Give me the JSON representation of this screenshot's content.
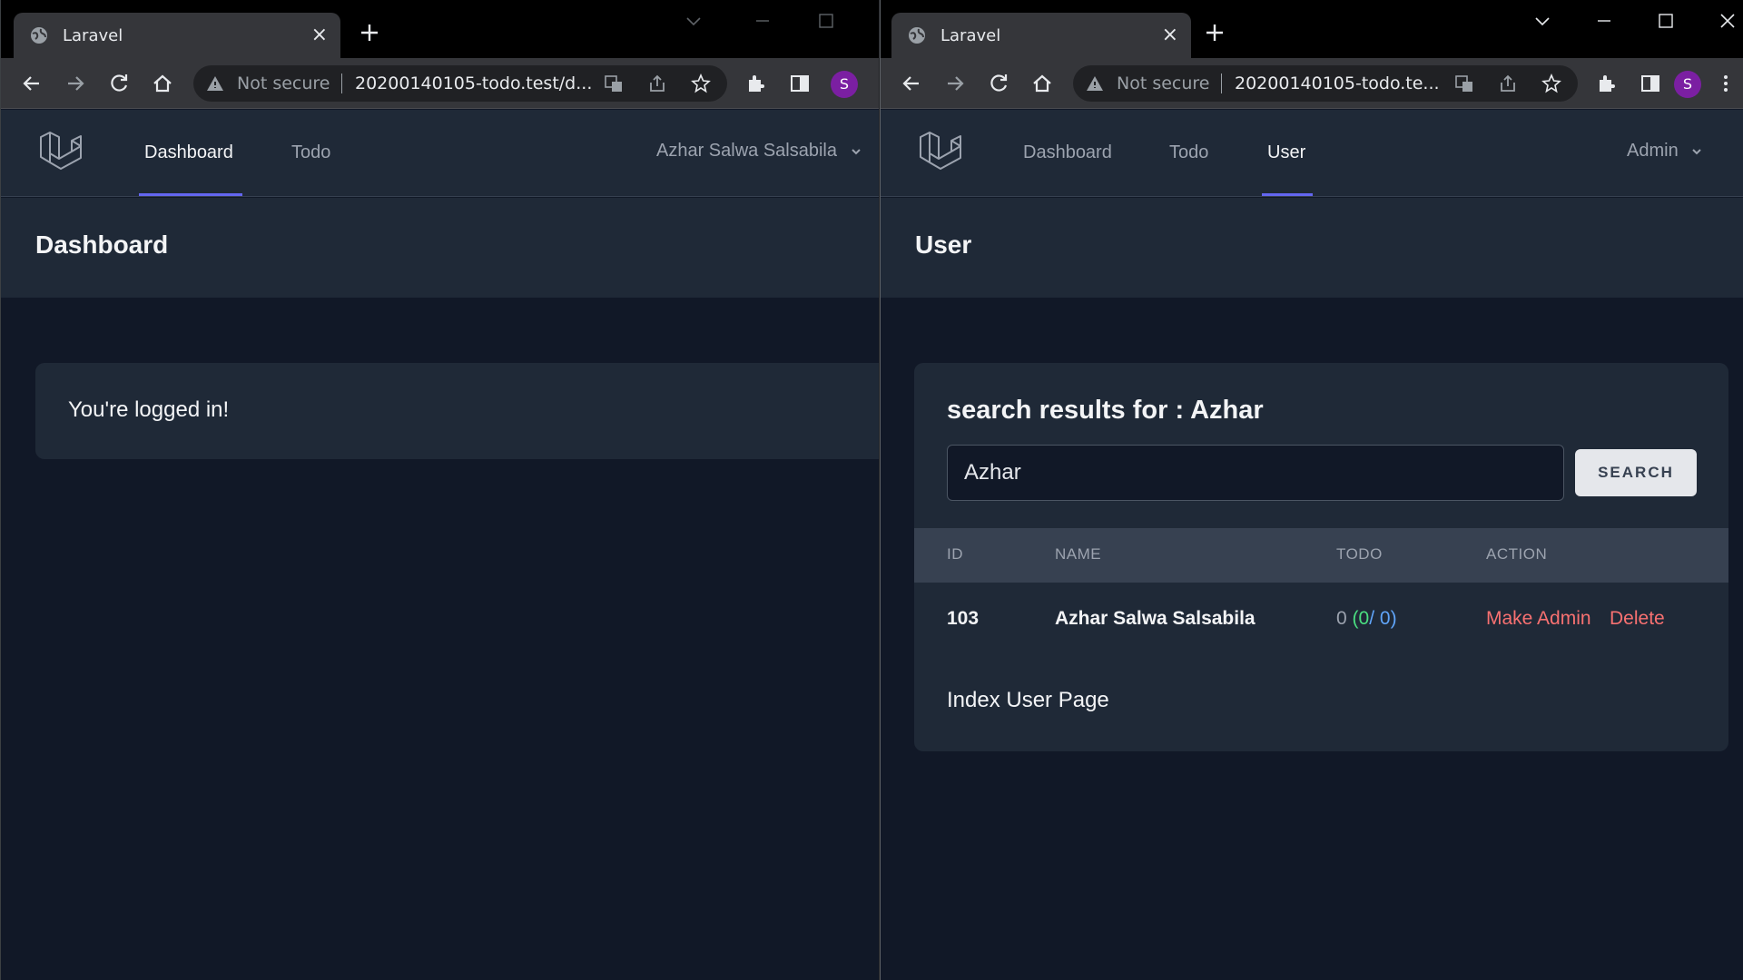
{
  "left_window": {
    "tab": {
      "title": "Laravel",
      "favicon": "globe-icon",
      "close": "×"
    },
    "address": {
      "security": "Not secure",
      "url": "20200140105-todo.test/d..."
    },
    "profile_initial": "S",
    "nav": {
      "links": [
        {
          "label": "Dashboard",
          "active": true
        },
        {
          "label": "Todo",
          "active": false
        }
      ],
      "user": "Azhar Salwa Salsabila"
    },
    "page_title": "Dashboard",
    "message": "You're logged in!"
  },
  "right_window": {
    "tab": {
      "title": "Laravel",
      "favicon": "globe-icon",
      "close": "×"
    },
    "address": {
      "security": "Not secure",
      "url": "20200140105-todo.te..."
    },
    "profile_initial": "S",
    "nav": {
      "links": [
        {
          "label": "Dashboard",
          "active": false
        },
        {
          "label": "Todo",
          "active": false
        },
        {
          "label": "User",
          "active": true
        }
      ],
      "user": "Admin"
    },
    "page_title": "User",
    "search": {
      "title": "search results for : Azhar",
      "value": "Azhar",
      "button": "SEARCH"
    },
    "table": {
      "headers": [
        "ID",
        "NAME",
        "TODO",
        "ACTION"
      ],
      "rows": [
        {
          "id": "103",
          "name": "Azhar Salwa Salsabila",
          "todo_total": "0",
          "todo_done": "0",
          "todo_open": "0",
          "actions": [
            "Make Admin",
            "Delete"
          ]
        }
      ]
    },
    "footer_text": "Index User Page"
  },
  "colors": {
    "accent": "#6366f1",
    "danger": "#f87171",
    "success": "#4ade80",
    "info": "#60a5fa",
    "avatar": "#7b1fa2"
  }
}
